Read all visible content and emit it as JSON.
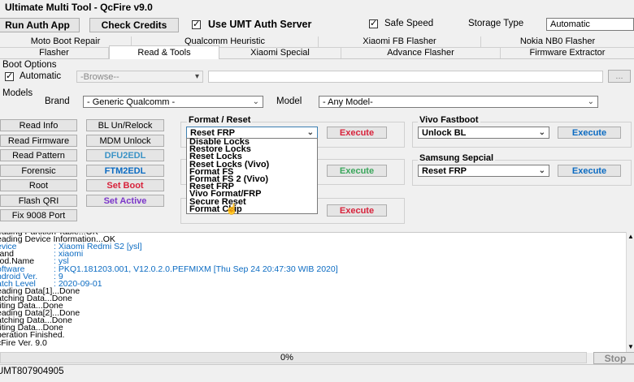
{
  "window": {
    "title": "Ultimate Multi Tool - QcFire v9.0"
  },
  "top_bar": {
    "run_auth_label": "Run Auth App",
    "check_credits_label": "Check Credits",
    "use_umt_auth_label": "Use UMT Auth Server",
    "safe_speed_label": "Safe Speed",
    "storage_type_label": "Storage Type",
    "storage_type_value": "Automatic"
  },
  "tabs_row1": [
    "Moto Boot Repair",
    "Qualcomm Heuristic",
    "Xiaomi FB Flasher",
    "Nokia NB0 Flasher"
  ],
  "tabs_row2": [
    "Flasher",
    "Read & Tools",
    "Xiaomi Special",
    "Advance Flasher",
    "Firmware Extractor"
  ],
  "boot_options": {
    "label": "Boot Options",
    "automatic_label": "Automatic",
    "browse_placeholder": "-Browse--",
    "dots_label": "..."
  },
  "models": {
    "label": "Models",
    "brand_label": "Brand",
    "brand_value": "- Generic Qualcomm -",
    "model_label": "Model",
    "model_value": "- Any Model-"
  },
  "left_buttons": {
    "read_info": "Read Info",
    "read_firmware": "Read Firmware",
    "read_pattern": "Read Pattern",
    "forensic": "Forensic",
    "root": "Root",
    "flash_qri": "Flash QRI",
    "fix_9008": "Fix 9008 Port"
  },
  "mid_buttons": {
    "bl_unrelock": "BL Un/Relock",
    "mdm_unlock": "MDM Unlock",
    "dfu2edl": "DFU2EDL",
    "ftm2edl": "FTM2EDL",
    "set_boot": "Set Boot",
    "set_active": "Set Active"
  },
  "format_reset": {
    "label": "Format / Reset",
    "selected": "Reset FRP",
    "execute_label": "Execute",
    "options": [
      "Disable Locks",
      "Restore Locks",
      "Reset Locks",
      "Reset Locks (Vivo)",
      "Format FS",
      "Format FS 2 (Vivo)",
      "Reset FRP",
      "Vivo Format/FRP",
      "Secure Reset",
      "Format Chip"
    ]
  },
  "vivo_fastboot": {
    "label": "Vivo Fastboot",
    "selected": "Unlock BL",
    "execute_label": "Execute"
  },
  "samsung_special": {
    "label": "Samsung Sepcial",
    "selected": "Reset FRP",
    "execute_label": "Execute"
  },
  "log_lines": [
    {
      "key": "eading Partition Table...OK",
      "value": ""
    },
    {
      "key": "eading Device Information...OK",
      "value": ""
    },
    {
      "key": "evice",
      "value": ": Xiaomi Redmi S2 [ysl]",
      "blue_key": true
    },
    {
      "key": "rand",
      "value": ": xiaomi"
    },
    {
      "key": "rod.Name",
      "value": ": ysl"
    },
    {
      "key": "oftware",
      "value": ": PKQ1.181203.001, V12.0.2.0.PEFMIXM [Thu Sep 24 20:47:30 WIB 2020]",
      "blue_key": true
    },
    {
      "key": "ndroid Ver.",
      "value": ": 9",
      "blue_key": true
    },
    {
      "key": "atch Level",
      "value": ": 2020-09-01",
      "blue_key": true
    },
    {
      "key": "eading Data[1]...Done",
      "value": ""
    },
    {
      "key": "atching Data...Done",
      "value": ""
    },
    {
      "key": "riting Data...Done",
      "value": ""
    },
    {
      "key": "eading Data[2]...Done",
      "value": ""
    },
    {
      "key": "atching Data...Done",
      "value": ""
    },
    {
      "key": "riting Data...Done",
      "value": ""
    },
    {
      "key": "peration Finished.",
      "value": ""
    },
    {
      "key": "cFire Ver. 9.0",
      "value": ""
    }
  ],
  "progress": {
    "text": "0%",
    "value": 0
  },
  "stop_label": "Stop",
  "status": {
    "serial": "UMT807904905"
  }
}
